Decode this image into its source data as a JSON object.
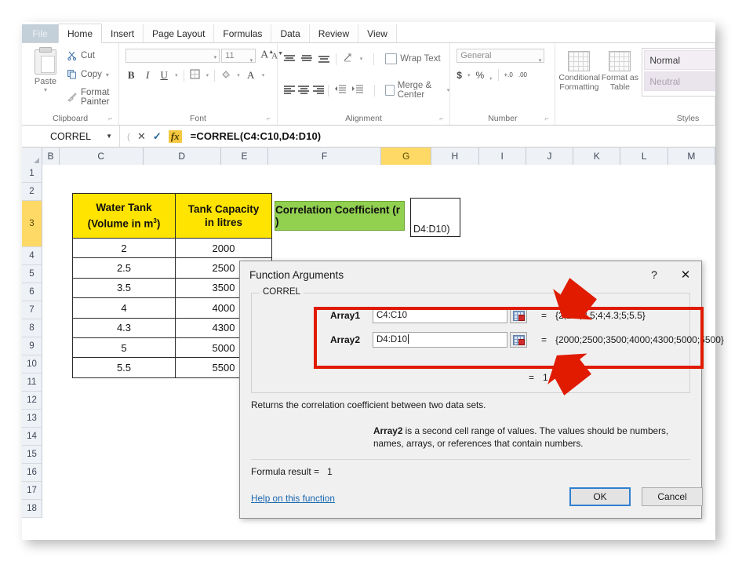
{
  "app": {
    "title": "Microsoft Excel",
    "ribbon_tabs": [
      {
        "label": "File",
        "active": false
      },
      {
        "label": "Home",
        "active": true
      },
      {
        "label": "Insert",
        "active": false
      },
      {
        "label": "Page Layout",
        "active": false
      },
      {
        "label": "Formulas",
        "active": false
      },
      {
        "label": "Data",
        "active": false
      },
      {
        "label": "Review",
        "active": false
      },
      {
        "label": "View",
        "active": false
      }
    ]
  },
  "ribbon": {
    "clipboard": {
      "group_label": "Clipboard",
      "paste_label": "Paste",
      "cut_label": "Cut",
      "copy_label": "Copy",
      "format_painter_label": "Format Painter"
    },
    "font": {
      "group_label": "Font",
      "font_name": "",
      "font_size": "11",
      "grow_font": "A",
      "shrink_font": "A",
      "bold": "B",
      "italic": "I",
      "underline": "U"
    },
    "alignment": {
      "group_label": "Alignment",
      "wrap_text_label": "Wrap Text",
      "merge_center_label": "Merge & Center"
    },
    "number": {
      "group_label": "Number",
      "format_value": "General",
      "currency": "$",
      "percent": "%",
      "comma": ",",
      "increase_decimal": "+.0",
      "decrease_decimal": ".00"
    },
    "styles": {
      "group_label": "Styles",
      "conditional_formatting_label": "Conditional Formatting",
      "format_as_table_label": "Format as Table",
      "cell_style_normal": "Normal",
      "cell_style_neutral": "Neutral"
    }
  },
  "formula_bar": {
    "name_box": "CORREL",
    "cancel_icon": "✕",
    "enter_icon": "✓",
    "fx_label": "fx",
    "formula": "=CORREL(C4:C10,D4:D10)"
  },
  "grid": {
    "columns": [
      "B",
      "C",
      "D",
      "E",
      "F",
      "G",
      "H",
      "I",
      "J",
      "K",
      "L",
      "M"
    ],
    "selected_column": "G",
    "rows": [
      "1",
      "2",
      "3",
      "4",
      "5",
      "6",
      "7",
      "8",
      "9",
      "10",
      "11",
      "12",
      "13",
      "14",
      "15",
      "16",
      "17",
      "18"
    ],
    "selected_row": "3"
  },
  "data_table": {
    "header_col1_line1": "Water Tank",
    "header_col1_line2_pre": "(Volume in m",
    "header_col1_sup": "3",
    "header_col1_line2_post": ")",
    "header_col2_line1": "Tank Capacity",
    "header_col2_line2": "in litres",
    "rows": [
      {
        "volume": "2",
        "capacity": "2000"
      },
      {
        "volume": "2.5",
        "capacity": "2500"
      },
      {
        "volume": "3.5",
        "capacity": "3500"
      },
      {
        "volume": "4",
        "capacity": "4000"
      },
      {
        "volume": "4.3",
        "capacity": "4300"
      },
      {
        "volume": "5",
        "capacity": "5000"
      },
      {
        "volume": "5.5",
        "capacity": "5500"
      }
    ]
  },
  "correlation_cell": {
    "label": "Correlation Coefficient (r )",
    "cell_text": "D4:D10)"
  },
  "dialog": {
    "title": "Function Arguments",
    "help_icon": "?",
    "close_icon": "✕",
    "function_name": "CORREL",
    "args": [
      {
        "label": "Array1",
        "value": "C4:C10",
        "equals": "=",
        "result": "{2;2.5;3.5;4;4.3;5;5.5}",
        "focused": false
      },
      {
        "label": "Array2",
        "value": "D4:D10",
        "equals": "=",
        "result": "{2000;2500;3500;4000;4300;5000;5500}",
        "focused": true
      }
    ],
    "intermediate_equals": "=",
    "intermediate_result": "1",
    "description": "Returns the correlation coefficient between two data sets.",
    "arg_help_name": "Array2",
    "arg_help_text": "is a second cell range of values. The values should be numbers, names, arrays, or references that contain numbers.",
    "formula_result_label": "Formula result =",
    "formula_result_value": "1",
    "help_link": "Help on this function",
    "ok_label": "OK",
    "cancel_label": "Cancel"
  },
  "annotations": {
    "highlight_color": "#e01b00",
    "arrow_down_name": "red-arrow-down",
    "arrow_up_name": "red-arrow-up"
  },
  "colors": {
    "header_yellow": "#ffe400",
    "label_green": "#92d050",
    "selection_amber": "#ffd966",
    "annotation_red": "#e01b00",
    "link_blue": "#1767b0"
  }
}
